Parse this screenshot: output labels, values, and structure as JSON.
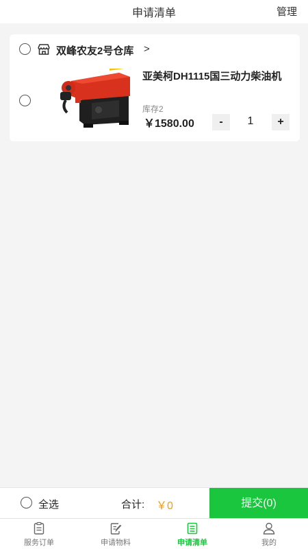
{
  "header": {
    "title": "申请清单",
    "manage_label": "管理"
  },
  "store": {
    "name": "双峰农友2号仓库",
    "arrow": ">",
    "icon": "store-icon"
  },
  "item": {
    "name": "亚美柯DH1115国三动力柴油机",
    "stock": "库存2",
    "price": "￥1580.00",
    "minus": "-",
    "quantity": "1",
    "plus": "+"
  },
  "action_bar": {
    "select_all": "全选",
    "total_label": "合计:",
    "total_value": "￥0",
    "submit_label": "提交(0)"
  },
  "tabs": [
    {
      "label": "服务订单",
      "icon": "clipboard-icon",
      "active": false
    },
    {
      "label": "申请物料",
      "icon": "edit-document-icon",
      "active": false
    },
    {
      "label": "申请清单",
      "icon": "list-icon",
      "active": true
    },
    {
      "label": "我的",
      "icon": "user-icon",
      "active": false
    }
  ],
  "colors": {
    "accent": "#1ac63d",
    "price_highlight": "#f39c12"
  }
}
